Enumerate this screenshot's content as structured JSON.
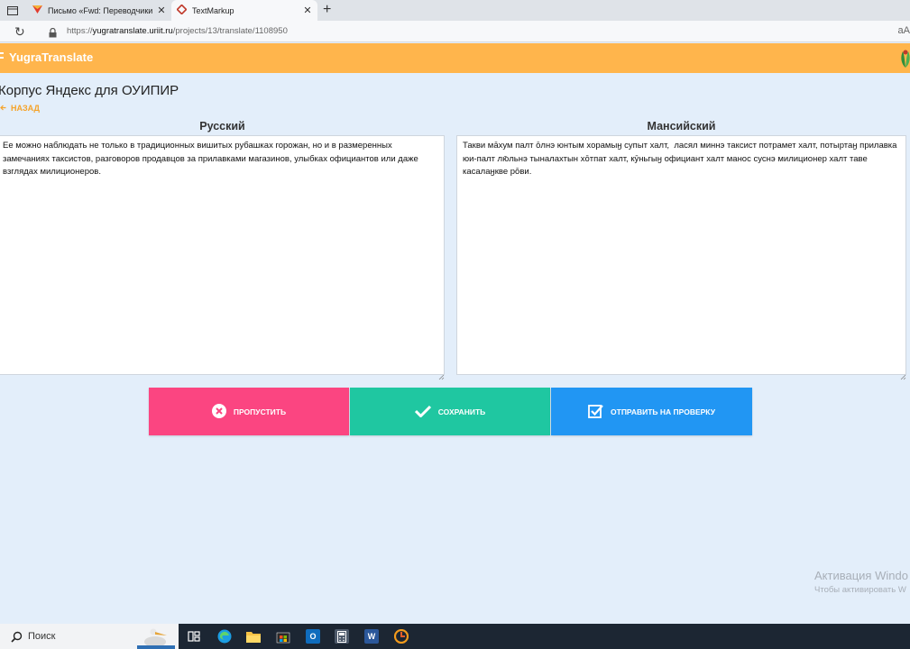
{
  "browser": {
    "tabs": [
      {
        "title": "Письмо «Fwd: Переводчики и э...",
        "icon": "mail-icon"
      },
      {
        "title": "TextMarkup",
        "icon": "textmarkup-icon"
      }
    ],
    "url_prefix": "https://",
    "url_host": "yugratranslate.uriit.ru",
    "url_path": "/projects/13/translate/1108950",
    "right_text": "aA"
  },
  "app": {
    "brand": "YugraTranslate",
    "page_title": "Корпус Яндекс для ОУИПИР",
    "back_label": "НАЗАД",
    "source": {
      "language": "Русский",
      "text": "Ее можно наблюдать не только в традиционных вишитых рубашках горожан, но и в размеренных замечаниях таксистов, разговоров продавцов за прилавками магазинов, улыбках официантов или даже взглядах милиционеров."
    },
    "target": {
      "language": "Мансийский",
      "text": "Такви мāхум палт ōлнэ юнтым хорамыӈ супыт халт,  ласял миннэ таксист потрамет халт, потыртаӈ прилавка юи-палт лю̄льнэ тыналахтын хōтпат халт, кӯньгыӈ официант халт манос суснэ милиционер халт таве касалаӈкве рōви."
    },
    "buttons": {
      "skip": "ПРОПУСТИТЬ",
      "save": "СОХРАНИТЬ",
      "review": "ОТПРАВИТЬ НА ПРОВЕРКУ"
    },
    "colors": {
      "header": "#ffb54c",
      "skip": "#fb4581",
      "save": "#1fc7a1",
      "review": "#2196f3",
      "background": "#e3eefa"
    }
  },
  "os": {
    "activation_line1": "Активация Windo",
    "activation_line2": "Чтобы активировать W",
    "search_placeholder": "Поиск"
  }
}
